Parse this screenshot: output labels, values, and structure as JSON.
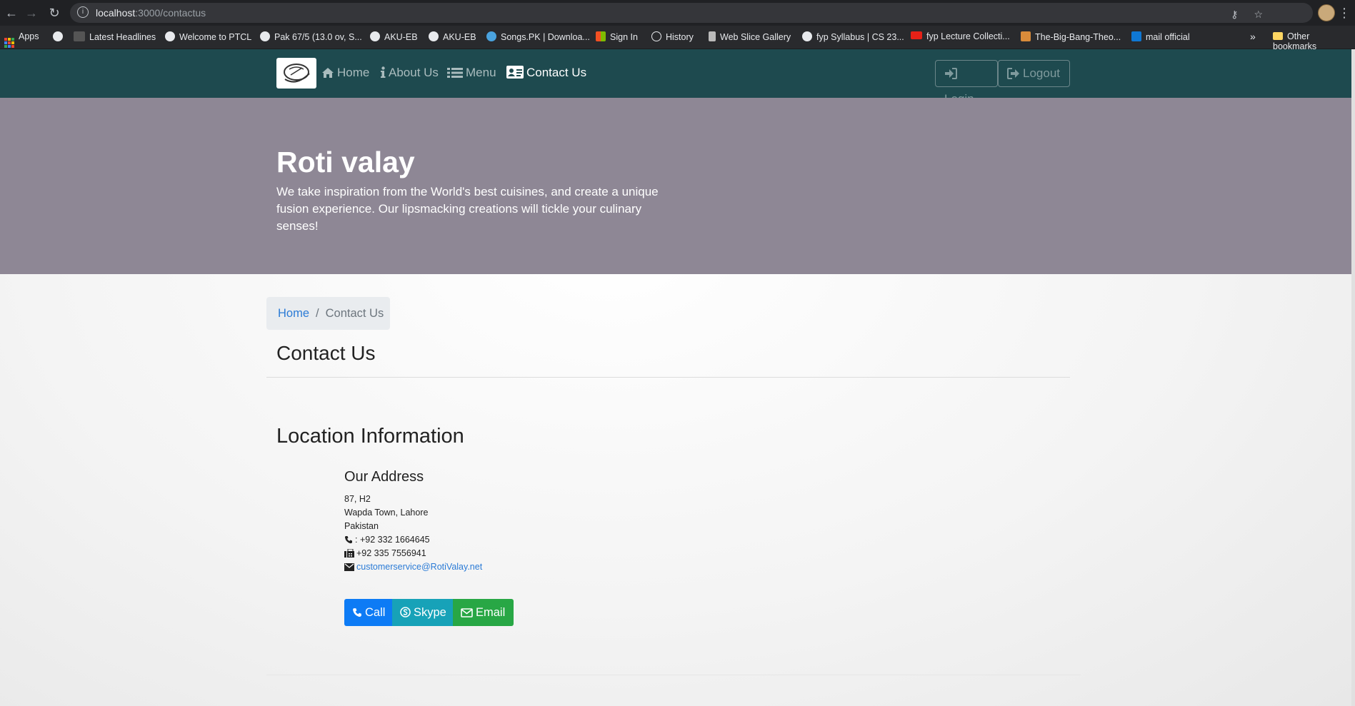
{
  "browser": {
    "url_host": "localhost",
    "url_path": ":3000/contactus",
    "bookmarks": [
      {
        "label": "Apps"
      },
      {
        "label": ""
      },
      {
        "label": "Latest Headlines"
      },
      {
        "label": "Welcome to PTCL"
      },
      {
        "label": "Pak 67/5 (13.0 ov, S..."
      },
      {
        "label": "AKU-EB"
      },
      {
        "label": "AKU-EB"
      },
      {
        "label": "Songs.PK | Downloa..."
      },
      {
        "label": "Sign In"
      },
      {
        "label": "History"
      },
      {
        "label": "Web Slice Gallery"
      },
      {
        "label": "fyp Syllabus | CS 23..."
      },
      {
        "label": "fyp Lecture Collecti..."
      },
      {
        "label": "The-Big-Bang-Theo..."
      },
      {
        "label": "mail official"
      }
    ],
    "more": "»",
    "other_bookmarks": "Other bookmarks"
  },
  "navbar": {
    "home": "Home",
    "about": "About Us",
    "menu": "Menu",
    "contact": "Contact Us",
    "login": "Login",
    "logout": "Logout"
  },
  "jumbotron": {
    "title": "Roti valay",
    "text": "We take inspiration from the World's best cuisines, and create a unique fusion experience. Our lipsmacking creations will tickle your culinary senses!"
  },
  "breadcrumb": {
    "home": "Home",
    "separator": "/",
    "current": "Contact Us"
  },
  "content": {
    "heading": "Contact Us",
    "location_heading": "Location Information",
    "address_heading": "Our Address",
    "address_line1": "87, H2",
    "address_line2": "Wapda Town, Lahore",
    "address_line3": "Pakistan",
    "phone": ": +92 332 1664645",
    "fax": "+92 335 7556941",
    "email": "customerservice@RotiValay.net"
  },
  "buttons": {
    "call": "Call",
    "skype": "Skype",
    "email": "Email"
  },
  "colors": {
    "navbar_bg": "#1e4a4f",
    "jumbotron_bg": "#8e8795",
    "call_btn": "#0d7bf5",
    "skype_btn": "#17a2b8",
    "email_btn": "#28a745",
    "link": "#2b7bd6"
  }
}
